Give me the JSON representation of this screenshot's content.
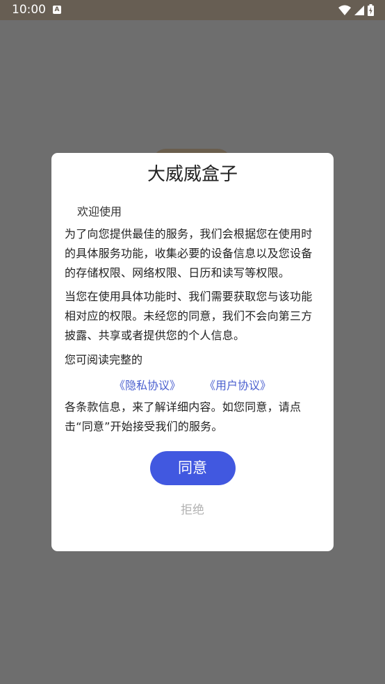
{
  "status_bar": {
    "time": "10:00",
    "notification_icon_letter": "A",
    "icons": [
      "wifi-icon",
      "signal-icon",
      "battery-icon"
    ],
    "background_color": "#675e53"
  },
  "dialog": {
    "title": "大威威盒子",
    "welcome": "欢迎使用",
    "paragraph1": "为了向您提供最佳的服务，我们会根据您在使用时的具体服务功能，收集必要的设备信息以及您设备的存储权限、网络权限、日历和读写等权限。",
    "paragraph2": "当您在使用具体功能时、我们需要获取您与该功能相对应的权限。未经您的同意，我们不会向第三方披露、共享或者提供您的个人信息。",
    "read_label": "您可阅读完整的",
    "privacy_link": "《隐私协议》",
    "user_link": "《用户协议》",
    "paragraph3": "各条款信息，来了解详细内容。如您同意，请点击“同意”开始接受我们的服务。",
    "agree_button": "同意",
    "reject_button": "拒绝"
  },
  "colors": {
    "overlay": "#6e6e6e",
    "accent": "#4158e0",
    "link": "#4a5fcf",
    "muted": "#b2b2b2"
  }
}
